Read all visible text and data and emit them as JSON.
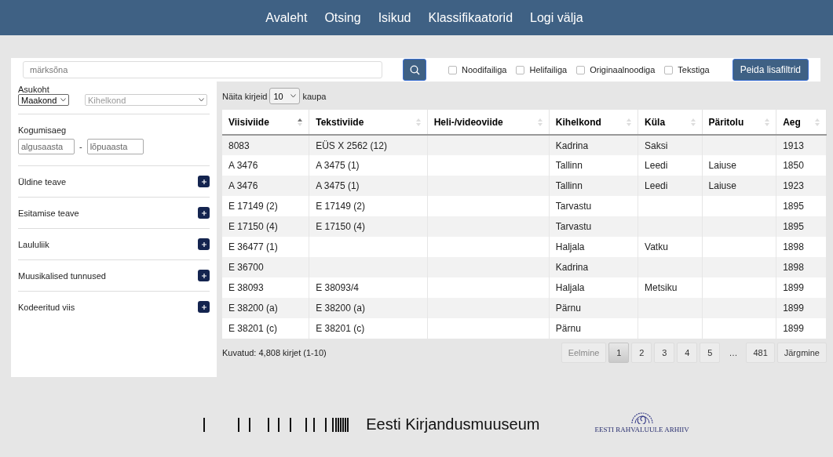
{
  "nav": {
    "items": [
      "Avaleht",
      "Otsing",
      "Isikud",
      "Klassifikaatorid",
      "Logi välja"
    ]
  },
  "search": {
    "placeholder": "märksõna"
  },
  "filters": [
    {
      "label": "Noodifailiga",
      "checked": false
    },
    {
      "label": "Helifailiga",
      "checked": false
    },
    {
      "label": "Originaalnoodiga",
      "checked": false
    },
    {
      "label": "Tekstiga",
      "checked": false
    }
  ],
  "hide_filters_button": "Peida lisafiltrid",
  "sidebar": {
    "location": {
      "label": "Asukoht",
      "county": "Maakond",
      "parish": {
        "value": "Kihelkond",
        "disabled": true
      }
    },
    "collection_time": {
      "label": "Kogumisaeg",
      "from_placeholder": "algusaasta",
      "separator": "-",
      "to_placeholder": "lõpuaasta"
    },
    "sections": [
      {
        "label": "Üldine teave",
        "expanded": false
      },
      {
        "label": "Esitamise teave",
        "expanded": false
      },
      {
        "label": "Laululiik",
        "expanded": false
      },
      {
        "label": "Muusikalised tunnused",
        "expanded": false
      },
      {
        "label": "Kodeeritud viis",
        "expanded": false
      }
    ]
  },
  "page_size": {
    "before": "Näita kirjeid",
    "value": "10",
    "after": "kaupa"
  },
  "table": {
    "columns": [
      {
        "label": "Viisiviide",
        "sorted": true
      },
      {
        "label": "Tekstiviide",
        "sorted": false
      },
      {
        "label": "Heli-/videoviide",
        "sorted": false
      },
      {
        "label": "Kihelkond",
        "sorted": false
      },
      {
        "label": "Küla",
        "sorted": false
      },
      {
        "label": "Päritolu",
        "sorted": false
      },
      {
        "label": "Aeg",
        "sorted": false
      }
    ],
    "rows": [
      [
        "8083",
        "EÜS X 2562 (12)",
        "",
        "Kadrina",
        "Saksi",
        "",
        "1913"
      ],
      [
        "A 3476",
        "A 3475 (1)",
        "",
        "Tallinn",
        "Leedi",
        "Laiuse",
        "1850"
      ],
      [
        "A 3476",
        "A 3475 (1)",
        "",
        "Tallinn",
        "Leedi",
        "Laiuse",
        "1923"
      ],
      [
        "E 17149 (2)",
        "E 17149 (2)",
        "",
        "Tarvastu",
        "",
        "",
        "1895"
      ],
      [
        "E 17150 (4)",
        "E 17150 (4)",
        "",
        "Tarvastu",
        "",
        "",
        "1895"
      ],
      [
        "E 36477 (1)",
        "",
        "",
        "Haljala",
        "Vatku",
        "",
        "1898"
      ],
      [
        "E 36700",
        "",
        "",
        "Kadrina",
        "",
        "",
        "1898"
      ],
      [
        "E 38093",
        "E 38093/4",
        "",
        "Haljala",
        "Metsiku",
        "",
        "1899"
      ],
      [
        "E 38200 (a)",
        "E 38200 (a)",
        "",
        "Pärnu",
        "",
        "",
        "1899"
      ],
      [
        "E 38201 (c)",
        "E 38201 (c)",
        "",
        "Pärnu",
        "",
        "",
        "1899"
      ]
    ]
  },
  "info": "Kuvatud: 4,808 kirjet (1-10)",
  "pagination": {
    "previous": {
      "label": "Eelmine",
      "disabled": true
    },
    "pages": [
      {
        "label": "1",
        "selected": true
      },
      {
        "label": "2",
        "selected": false
      },
      {
        "label": "3",
        "selected": false
      },
      {
        "label": "4",
        "selected": false
      },
      {
        "label": "5",
        "selected": false
      },
      {
        "label": "…",
        "kind": "ellipsis"
      },
      {
        "label": "481",
        "selected": false
      }
    ],
    "next": {
      "label": "Järgmine",
      "disabled": false
    }
  },
  "footer": {
    "museum": "Eesti Kirjandusmuuseum",
    "archive": "EESTI RAHVALUULE ARHIIV"
  }
}
